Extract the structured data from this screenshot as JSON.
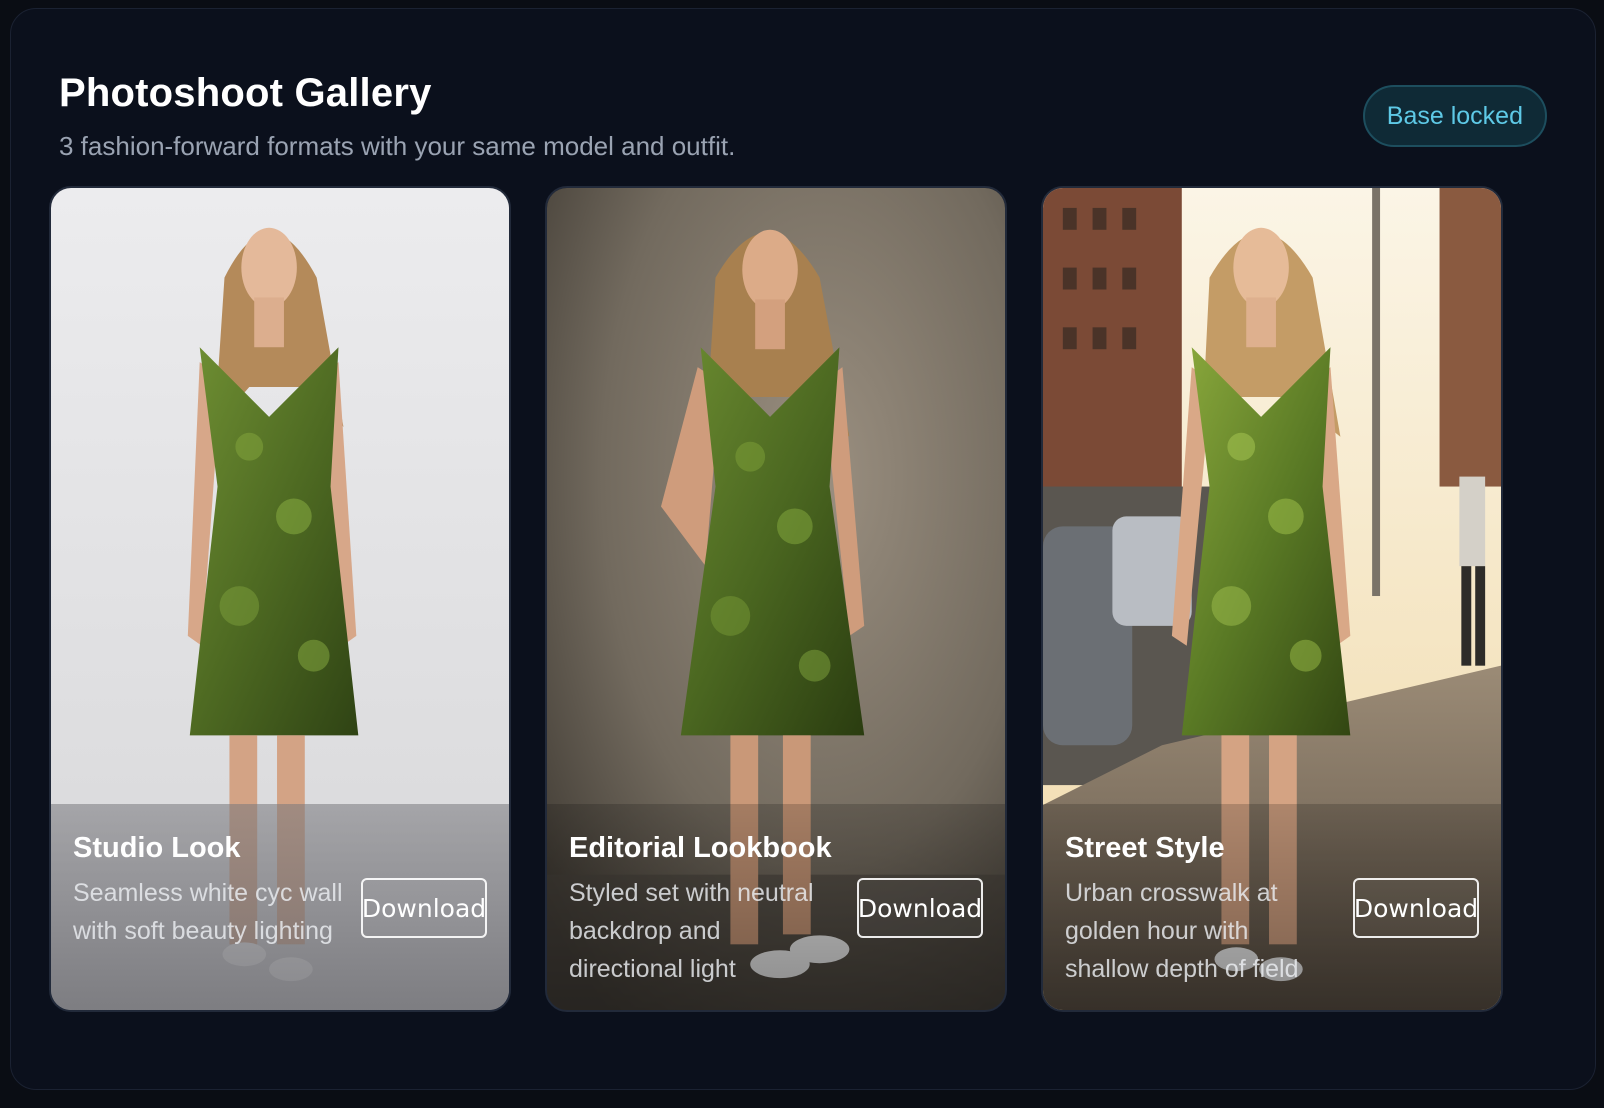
{
  "header": {
    "title": "Photoshoot Gallery",
    "subtitle": "3 fashion-forward formats with your same model and outfit.",
    "badge": "Base locked"
  },
  "cards": [
    {
      "title": "Studio Look",
      "description": "Seamless white cyc wall with soft beauty lighting",
      "button": "Download"
    },
    {
      "title": "Editorial Lookbook",
      "description": "Styled set with neutral backdrop and directional light",
      "button": "Download"
    },
    {
      "title": "Street Style",
      "description": "Urban crosswalk at golden hour with shallow depth of field",
      "button": "Download"
    }
  ],
  "colors": {
    "background": "#0b101c",
    "badge_text": "#5ec9e6",
    "badge_border": "#1d4e5e",
    "dress_green": "#5d7a2a"
  },
  "icons": []
}
